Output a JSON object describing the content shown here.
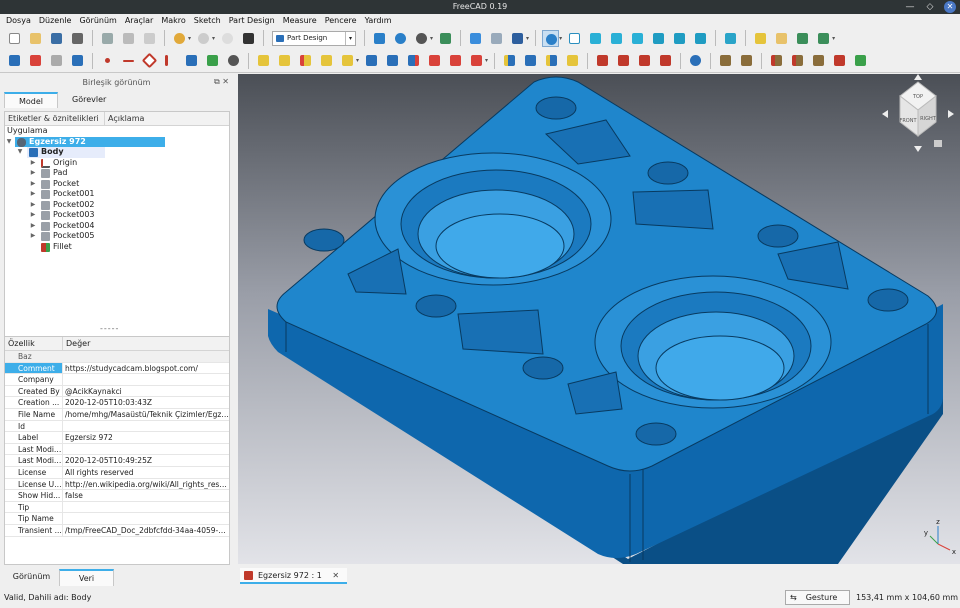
{
  "window": {
    "title": "FreeCAD 0.19"
  },
  "menu": [
    "Dosya",
    "Düzenle",
    "Görünüm",
    "Araçlar",
    "Makro",
    "Sketch",
    "Part Design",
    "Measure",
    "Pencere",
    "Yardım"
  ],
  "workbench": {
    "selected": "Part Design"
  },
  "panel": {
    "title": "Birleşik görünüm",
    "tabs": [
      "Model",
      "Görevler"
    ],
    "tree_headers": [
      "Etiketler & öznitelikleri",
      "Açıklama"
    ],
    "tree_root": "Uygulama",
    "document": "Egzersiz 972",
    "body": "Body",
    "features": [
      "Origin",
      "Pad",
      "Pocket",
      "Pocket001",
      "Pocket002",
      "Pocket003",
      "Pocket004",
      "Pocket005",
      "Fillet"
    ],
    "splitter": "-----"
  },
  "props": {
    "headers": [
      "Özellik",
      "Değer"
    ],
    "group": "Baz",
    "rows": [
      {
        "k": "Comment",
        "v": "https://studycadcam.blogspot.com/"
      },
      {
        "k": "Company",
        "v": ""
      },
      {
        "k": "Created By",
        "v": "@AcikKaynakci"
      },
      {
        "k": "Creation ...",
        "v": "2020-12-05T10:03:43Z"
      },
      {
        "k": "File Name",
        "v": "/home/mhg/Masaüstü/Teknik Çizimler/Egzer..."
      },
      {
        "k": "Id",
        "v": ""
      },
      {
        "k": "Label",
        "v": "Egzersiz 972"
      },
      {
        "k": "Last Modif...",
        "v": ""
      },
      {
        "k": "Last Modif...",
        "v": "2020-12-05T10:49:25Z"
      },
      {
        "k": "License",
        "v": "All rights reserved"
      },
      {
        "k": "License URL",
        "v": "http://en.wikipedia.org/wiki/All_rights_reser..."
      },
      {
        "k": "Show Hid...",
        "v": "false"
      },
      {
        "k": "Tip",
        "v": ""
      },
      {
        "k": "Tip Name",
        "v": ""
      },
      {
        "k": "Transient ...",
        "v": "/tmp/FreeCAD_Doc_2dbfcfdd-34aa-4059-85..."
      }
    ]
  },
  "bottom_tabs": [
    "Görünüm",
    "Veri"
  ],
  "doc_tab": {
    "label": "Egzersiz 972 : 1"
  },
  "navcube": {
    "front": "FRONT",
    "top": "TOP",
    "right": "RIGHT"
  },
  "axis": {
    "x": "x",
    "y": "y",
    "z": "z"
  },
  "status": {
    "message": "Valid, Dahili adı: Body",
    "nav_style": "Gesture",
    "dimensions": "153,41 mm x 104,60 mm"
  },
  "colors": {
    "part": "#1f86cc",
    "part_dark": "#0d5d9c",
    "selection": "#3daee9"
  }
}
